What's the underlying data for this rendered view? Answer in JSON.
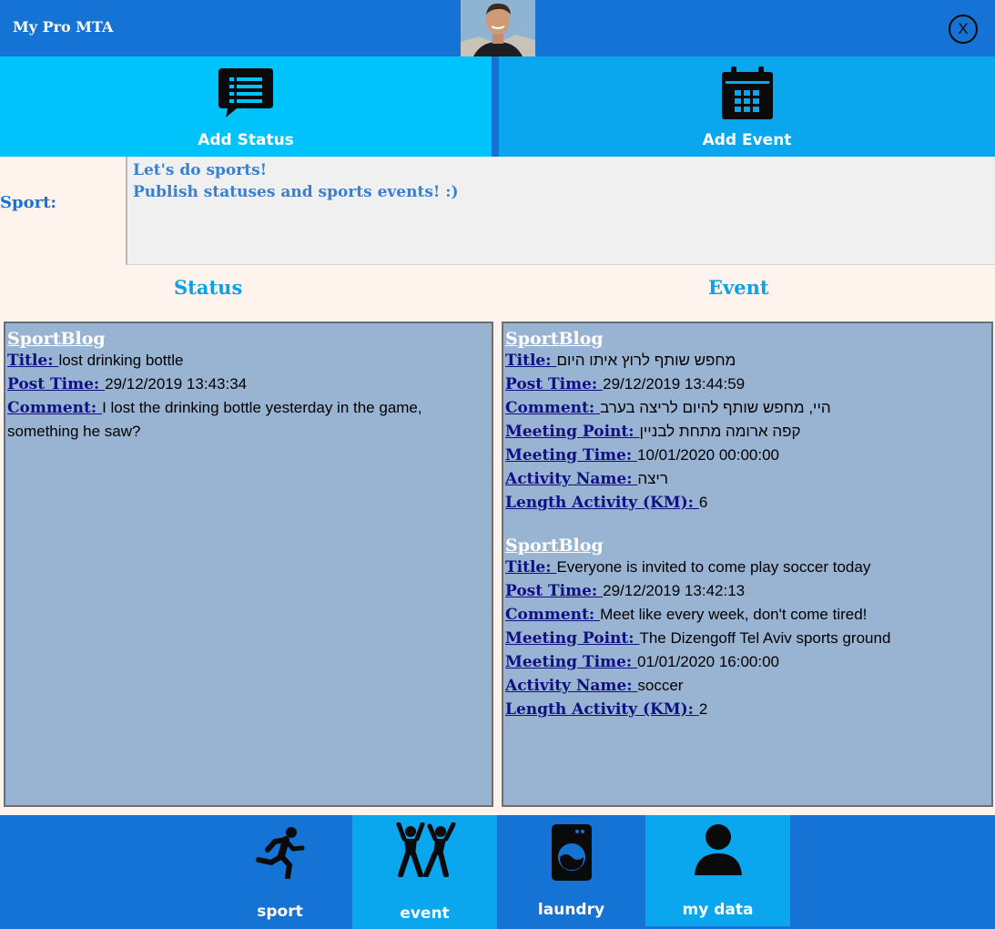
{
  "app": {
    "title": "My Pro MTA",
    "close_label": "X"
  },
  "actions": {
    "add_status": "Add Status",
    "add_event": "Add Event"
  },
  "sport": {
    "label": "Sport:",
    "message_line1": "Let's do sports!",
    "message_line2": "Publish statuses and sports events! :)"
  },
  "columns": {
    "status": "Status",
    "event": "Event"
  },
  "labels": {
    "blog": "SportBlog",
    "title": "Title: ",
    "post_time": "Post Time: ",
    "comment": "Comment: ",
    "meeting_point": "Meeting Point: ",
    "meeting_time": "Meeting Time: ",
    "activity_name": "Activity Name: ",
    "length_activity": "Length Activity (KM): "
  },
  "status_posts": [
    {
      "title": "lost drinking bottle",
      "post_time": "29/12/2019 13:43:34",
      "comment": "I lost the drinking bottle yesterday in the game, something he saw?"
    }
  ],
  "event_posts": [
    {
      "title": "מחפש שותף לרוץ איתו היום",
      "post_time": "29/12/2019 13:44:59",
      "comment": "היי, מחפש שותף להיום לריצה בערב",
      "meeting_point": "קפה ארומה מתחת לבניין",
      "meeting_time": "10/01/2020 00:00:00",
      "activity_name": "ריצה",
      "length": "6"
    },
    {
      "title": "Everyone is invited to come play soccer today",
      "post_time": "29/12/2019 13:42:13",
      "comment": "Meet like every week, don't come tired!",
      "meeting_point": "The Dizengoff Tel Aviv sports ground",
      "meeting_time": "01/01/2020 16:00:00",
      "activity_name": "soccer",
      "length": "2"
    }
  ],
  "nav": {
    "sport": "sport",
    "event": "event",
    "laundry": "laundry",
    "my_data": "my data"
  },
  "icons": {
    "close": "close-icon",
    "add_status": "chat-bubble-icon",
    "add_event": "calendar-icon",
    "sport": "runner-icon",
    "event": "people-cheering-icon",
    "laundry": "washing-machine-icon",
    "my_data": "user-icon"
  },
  "colors": {
    "title_bar": "#1673d6",
    "add_status_bg": "#00c3fc",
    "add_event_bg": "#0aa7ef",
    "panel_bg": "#98b4d2",
    "label_text": "#0f0f82",
    "header_text": "#0aa0ea",
    "page_bg": "#fff3ee"
  }
}
